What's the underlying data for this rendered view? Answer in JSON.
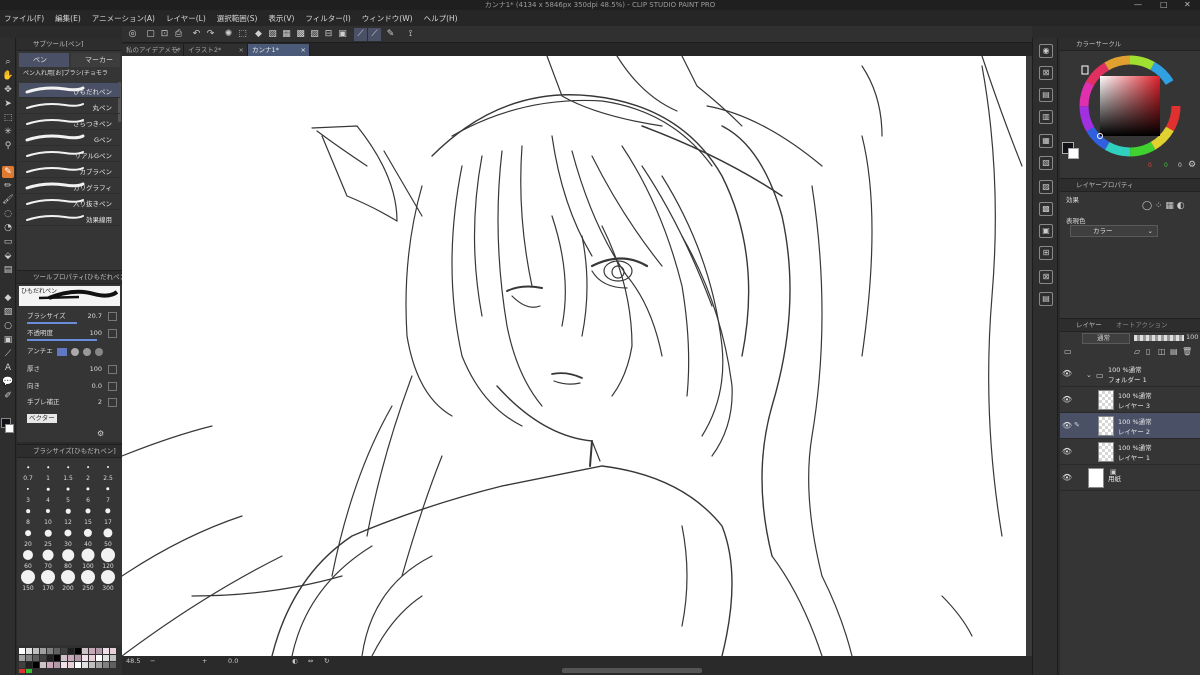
{
  "window": {
    "title": "カンナ1* (4134 x 5846px 350dpi 48.5%)  - CLIP STUDIO PAINT PRO",
    "controls": [
      "—",
      "□",
      "✕"
    ]
  },
  "menu": [
    "ファイル(F)",
    "編集(E)",
    "アニメーション(A)",
    "レイヤー(L)",
    "選択範囲(S)",
    "表示(V)",
    "フィルター(I)",
    "ウィンドウ(W)",
    "ヘルプ(H)"
  ],
  "subtool": {
    "header": "サブツール[ペン]",
    "tabs": [
      "ペン",
      "マーカー"
    ],
    "group_label": "ペン入れ用[お]ブラシ(チョモラ",
    "brushes": [
      "ひもだれペン",
      "丸ペン",
      "さらつきペン",
      "Gペン",
      "リアルGペン",
      "カブラペン",
      "カリグラフィ",
      "入り抜きペン",
      "効果線用"
    ],
    "selected_brush": "ひもだれペン"
  },
  "tool_property": {
    "header": "ツールプロパティ[ひもだれペン",
    "preview_label": "ひもだれペン",
    "rows": [
      {
        "label": "ブラシサイズ",
        "value": "20.7"
      },
      {
        "label": "不透明度",
        "value": "100"
      },
      {
        "label": "アンチエ",
        "value": ""
      },
      {
        "label": "厚さ",
        "value": "100"
      },
      {
        "label": "向き",
        "value": "0.0"
      },
      {
        "label": "手ブレ補正",
        "value": "2"
      },
      {
        "label": "ベクター",
        "value": ""
      }
    ]
  },
  "brush_size": {
    "header": "ブラシサイズ[ひもだれペン]",
    "sizes": [
      "0.7",
      "1",
      "1.5",
      "2",
      "2.5",
      "3",
      "4",
      "5",
      "6",
      "7",
      "8",
      "10",
      "12",
      "15",
      "17",
      "20",
      "25",
      "30",
      "40",
      "50",
      "60",
      "70",
      "80",
      "100",
      "120",
      "150",
      "170",
      "200",
      "250",
      "300"
    ]
  },
  "document_tabs": [
    {
      "label": "私のアイデアメモ*",
      "active": false
    },
    {
      "label": "イラスト2*",
      "active": false
    },
    {
      "label": "カンナ1*",
      "active": true
    }
  ],
  "status": {
    "zoom": "48.5",
    "angle": "0.0"
  },
  "color_panel": {
    "header": "カラーサークル",
    "values": [
      "0",
      "0",
      "0"
    ],
    "main_color": "#121218",
    "sub_color": "#ffffff"
  },
  "layer_property": {
    "header": "レイヤープロパティ",
    "effect_label": "効果",
    "expression_label": "表現色",
    "expression_value": "カラー"
  },
  "layers": {
    "tabs": [
      "レイヤー",
      "オートアクション"
    ],
    "blend_mode": "通常",
    "opacity": "100",
    "items": [
      {
        "line1": "100 %通常",
        "line2": "フォルダー 1",
        "type": "folder",
        "selected": false
      },
      {
        "line1": "100 %通常",
        "line2": "レイヤー 3",
        "type": "raster",
        "selected": false
      },
      {
        "line1": "100 %通常",
        "line2": "レイヤー 2",
        "type": "raster",
        "selected": true
      },
      {
        "line1": "100 %通常",
        "line2": "レイヤー 1",
        "type": "raster",
        "selected": false
      },
      {
        "line1": "",
        "line2": "用紙",
        "type": "paper",
        "selected": false
      }
    ]
  },
  "colors": {
    "accent": "#e07a30",
    "selection": "#4a5066",
    "tab_active": "#4c5a7a"
  }
}
